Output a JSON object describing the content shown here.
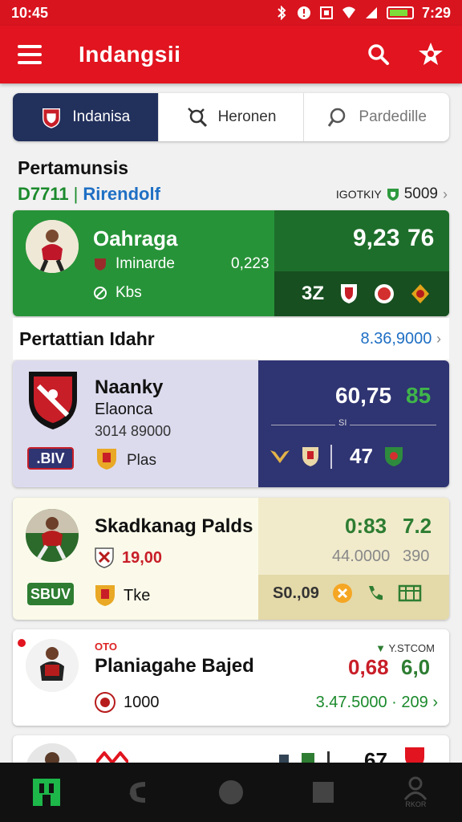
{
  "status_bar": {
    "time_left": "10:45",
    "time_right": "7:29"
  },
  "app_bar": {
    "title": "Indangsii",
    "menu_icon": "hamburger-icon",
    "search_icon": "search-icon",
    "profile_icon": "star-person-icon"
  },
  "tabs": [
    {
      "label": "Indanisa",
      "icon": "club-badge-icon",
      "active": true
    },
    {
      "label": "Heronen",
      "icon": "wrench-search-icon",
      "active": false
    },
    {
      "label": "Pardedille",
      "icon": "search-icon",
      "active": false
    }
  ],
  "section1": {
    "title": "Pertamunsis",
    "code": "D7711",
    "link": "Rirendolf",
    "meta_label": "IGOTKIY",
    "meta_value": "5009"
  },
  "card1": {
    "name": "Oahraga",
    "line1": "Iminarde",
    "line2": "Kbs",
    "value": "0,223",
    "big_left": "9,23",
    "big_right": "76",
    "bottom_number": "3Z"
  },
  "section2": {
    "title": "Pertattian Idahr",
    "link": "8.36,9000"
  },
  "card2": {
    "name": "Naanky",
    "sub": "Elaonca",
    "numbers": "3014 89000",
    "badge": ".BIV",
    "label": "Plas",
    "big_left": "60,75",
    "big_right": "85",
    "small_label": "SI",
    "bottom_number": "47"
  },
  "card3": {
    "name": "Skadkanag Palds",
    "price": "19,00",
    "badge": "SBUV",
    "label": "Tke",
    "big_left": "0:83",
    "big_right": "7.2",
    "mid_left": "44.0000",
    "mid_right": "390",
    "strip_value": "S0.,09"
  },
  "card4": {
    "tag": "OTO",
    "name": "Planiagahe Bajed",
    "value": "1000",
    "top_right": "Y.STCOM",
    "big_left": "0,68",
    "big_right": "6,0",
    "footer_left": "3.47.5000",
    "footer_right": "209"
  },
  "card5": {
    "big": "67"
  },
  "bottom_nav": {
    "profile_label": "RKOR"
  },
  "colors": {
    "primary_red": "#e1141f",
    "green": "#279338",
    "navy": "#2f3472",
    "tab_active": "#22305c"
  }
}
